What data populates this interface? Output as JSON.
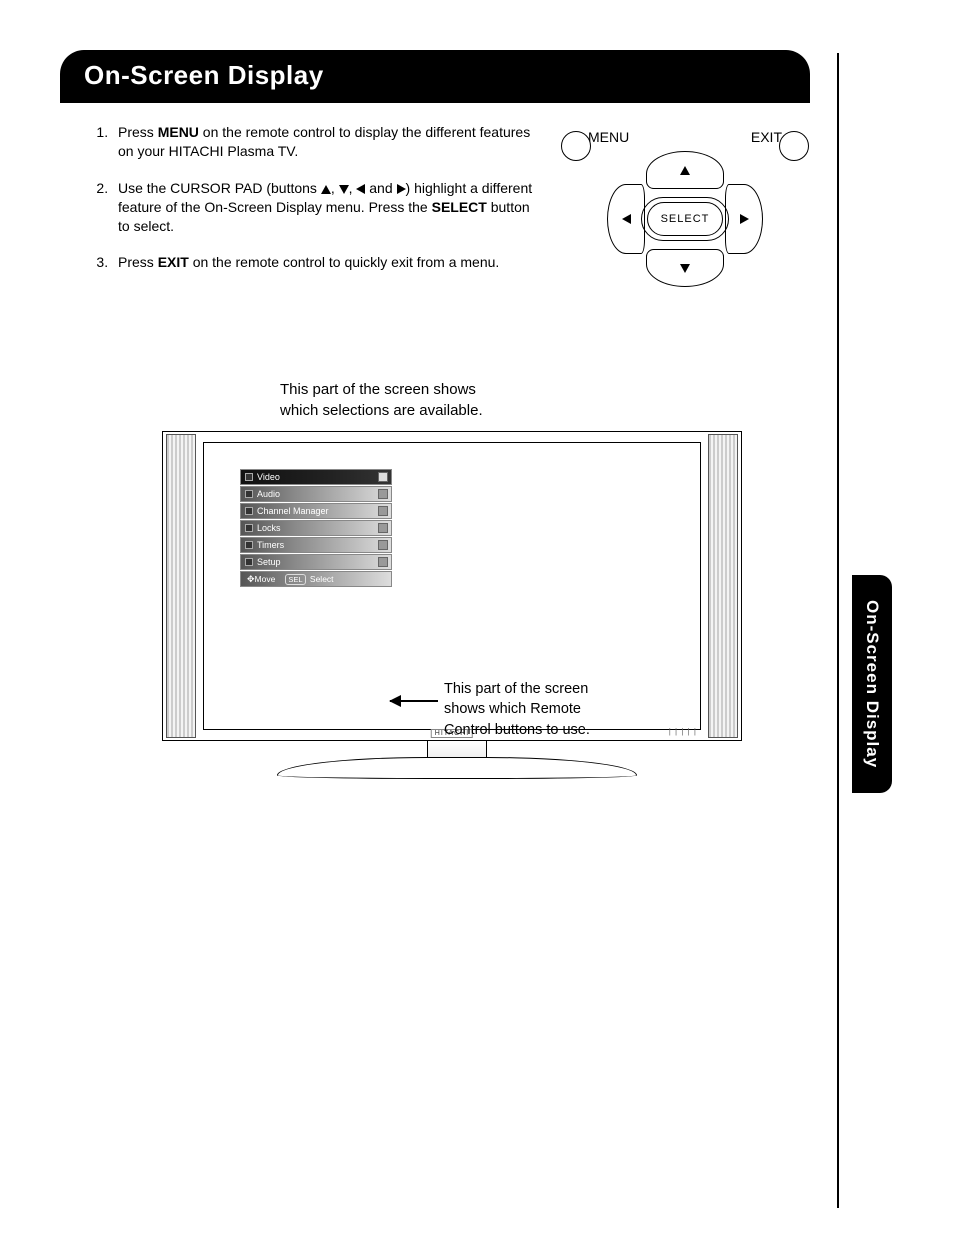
{
  "title": "On-Screen Display",
  "side_tab": "On-Screen Display",
  "instructions": [
    {
      "pre": "Press ",
      "bold": "MENU",
      "post": " on the remote control to display the different features on your HITACHI Plasma TV."
    },
    {
      "pre": "Use the CURSOR PAD  (buttons ",
      "arrows": true,
      "mid": ") highlight a different feature of the On-Screen Display menu. Press the ",
      "bold": "SELECT",
      "post": " button to select."
    },
    {
      "pre": "Press ",
      "bold": "EXIT",
      "post": " on the remote control to quickly exit from a menu."
    }
  ],
  "remote": {
    "menu_label": "MENU",
    "exit_label": "EXIT",
    "select_label": "SELECT"
  },
  "caption_top_line1": "This part of the screen shows",
  "caption_top_line2": "which selections are available.",
  "caption_right_line1": "This part of the screen",
  "caption_right_line2": "shows which Remote",
  "caption_right_line3": "Control buttons to use.",
  "osd_menu": {
    "items": [
      "Video",
      "Audio",
      "Channel Manager",
      "Locks",
      "Timers",
      "Setup"
    ],
    "footer_move_icon": "✥",
    "footer_move": "Move",
    "footer_sel_chip": "SEL",
    "footer_select": "Select"
  },
  "tv_brand": "HITACHI",
  "led_strip": "| | | | |"
}
